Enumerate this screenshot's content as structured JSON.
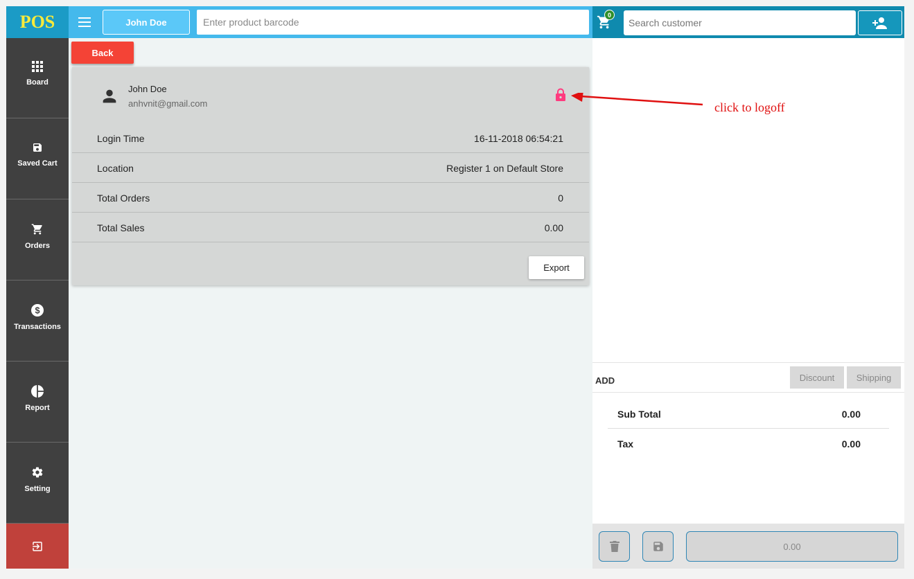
{
  "app": {
    "logo": "POS"
  },
  "header": {
    "user_button": "John Doe",
    "barcode_placeholder": "Enter product barcode",
    "cart_count": "0",
    "customer_placeholder": "Search customer"
  },
  "sidebar": {
    "items": [
      {
        "label": "Board",
        "icon": "grid-icon"
      },
      {
        "label": "Saved Cart",
        "icon": "floppy-disk-icon"
      },
      {
        "label": "Orders",
        "icon": "cart-icon"
      },
      {
        "label": "Transactions",
        "icon": "dollar-circle-icon"
      },
      {
        "label": "Report",
        "icon": "pie-chart-icon"
      },
      {
        "label": "Setting",
        "icon": "gear-icon"
      }
    ],
    "logout_icon": "exit-icon",
    "logout_color": "#c0413b"
  },
  "main": {
    "back_label": "Back",
    "profile": {
      "name": "John Doe",
      "email": "anhvnit@gmail.com"
    },
    "rows": [
      {
        "label": "Login Time",
        "value": "16-11-2018 06:54:21"
      },
      {
        "label": "Location",
        "value": "Register 1 on Default Store"
      },
      {
        "label": "Total Orders",
        "value": "0"
      },
      {
        "label": "Total Sales",
        "value": "0.00"
      }
    ],
    "export_label": "Export",
    "lock_color": "#ff3b7f"
  },
  "annotation": {
    "text": "click to logoff",
    "color": "#e01010"
  },
  "cart": {
    "add_label": "ADD",
    "discount_label": "Discount",
    "shipping_label": "Shipping",
    "totals": [
      {
        "label": "Sub Total",
        "value": "0.00"
      },
      {
        "label": "Tax",
        "value": "0.00"
      }
    ],
    "pay_amount": "0.00"
  }
}
